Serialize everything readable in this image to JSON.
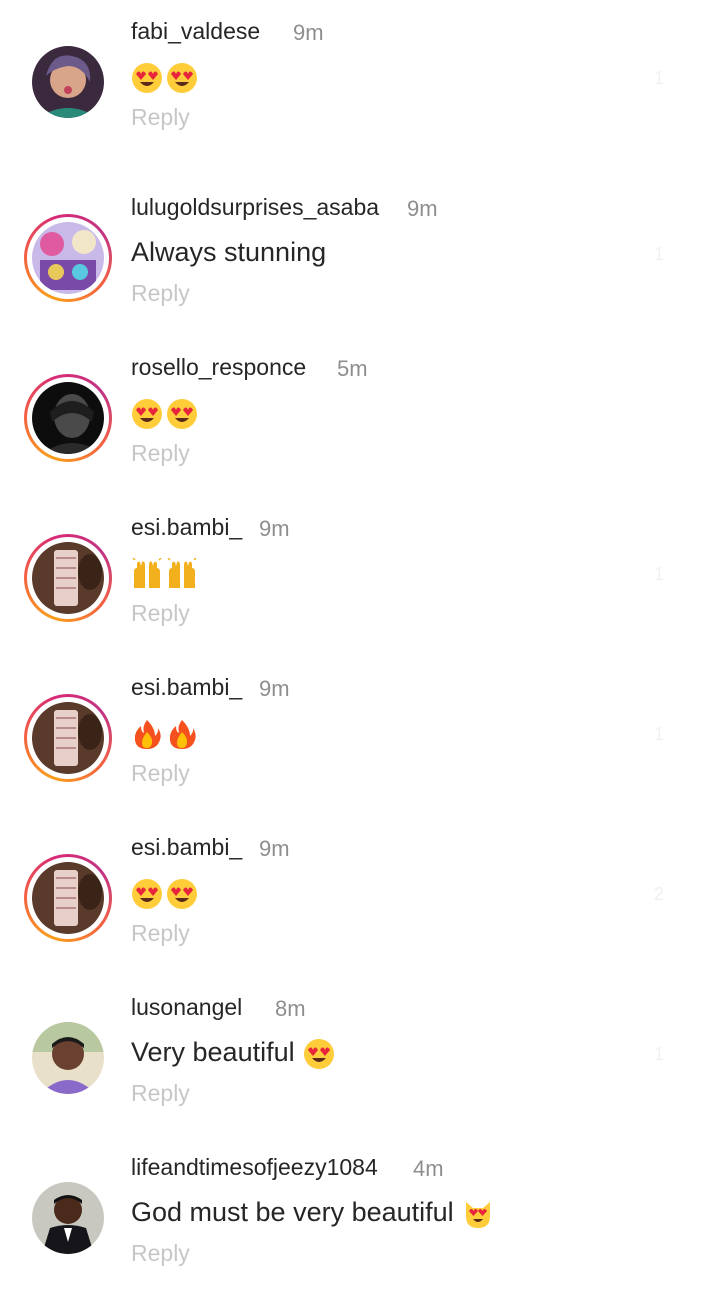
{
  "comments": [
    {
      "username": "fabi_valdese",
      "time": "9m",
      "text": "",
      "emojis": [
        "heart-eyes-face",
        "heart-eyes-face"
      ],
      "reply": "Reply",
      "likes": "1",
      "ring": false
    },
    {
      "username": "lulugoldsurprises_asaba",
      "time": "9m",
      "text": "Always stunning",
      "emojis": [],
      "reply": "Reply",
      "likes": "1",
      "ring": true
    },
    {
      "username": "rosello_responce",
      "time": "5m",
      "text": "",
      "emojis": [
        "heart-eyes-face",
        "heart-eyes-face"
      ],
      "reply": "Reply",
      "likes": "",
      "ring": true
    },
    {
      "username": "esi.bambi_",
      "time": "9m",
      "text": "",
      "emojis": [
        "raised-hands",
        "raised-hands"
      ],
      "reply": "Reply",
      "likes": "1",
      "ring": true
    },
    {
      "username": "esi.bambi_",
      "time": "9m",
      "text": "",
      "emojis": [
        "fire",
        "fire"
      ],
      "reply": "Reply",
      "likes": "1",
      "ring": true
    },
    {
      "username": "esi.bambi_",
      "time": "9m",
      "text": "",
      "emojis": [
        "heart-eyes-face",
        "heart-eyes-face"
      ],
      "reply": "Reply",
      "likes": "2",
      "ring": true
    },
    {
      "username": "lusonangel",
      "time": "8m",
      "text": "Very beautiful",
      "emojis": [
        "heart-eyes-face"
      ],
      "reply": "Reply",
      "likes": "1",
      "ring": false
    },
    {
      "username": "lifeandtimesofjeezy1084",
      "time": "4m",
      "text": "God must be very beautiful",
      "emojis": [
        "heart-eyes-cat"
      ],
      "reply": "Reply",
      "likes": "",
      "ring": false
    }
  ],
  "colors": {
    "username": "#262626",
    "time": "#8e8e8e",
    "reply": "#c7c7c7",
    "story_ring_start": "#f9a01b",
    "story_ring_end": "#c13584"
  }
}
